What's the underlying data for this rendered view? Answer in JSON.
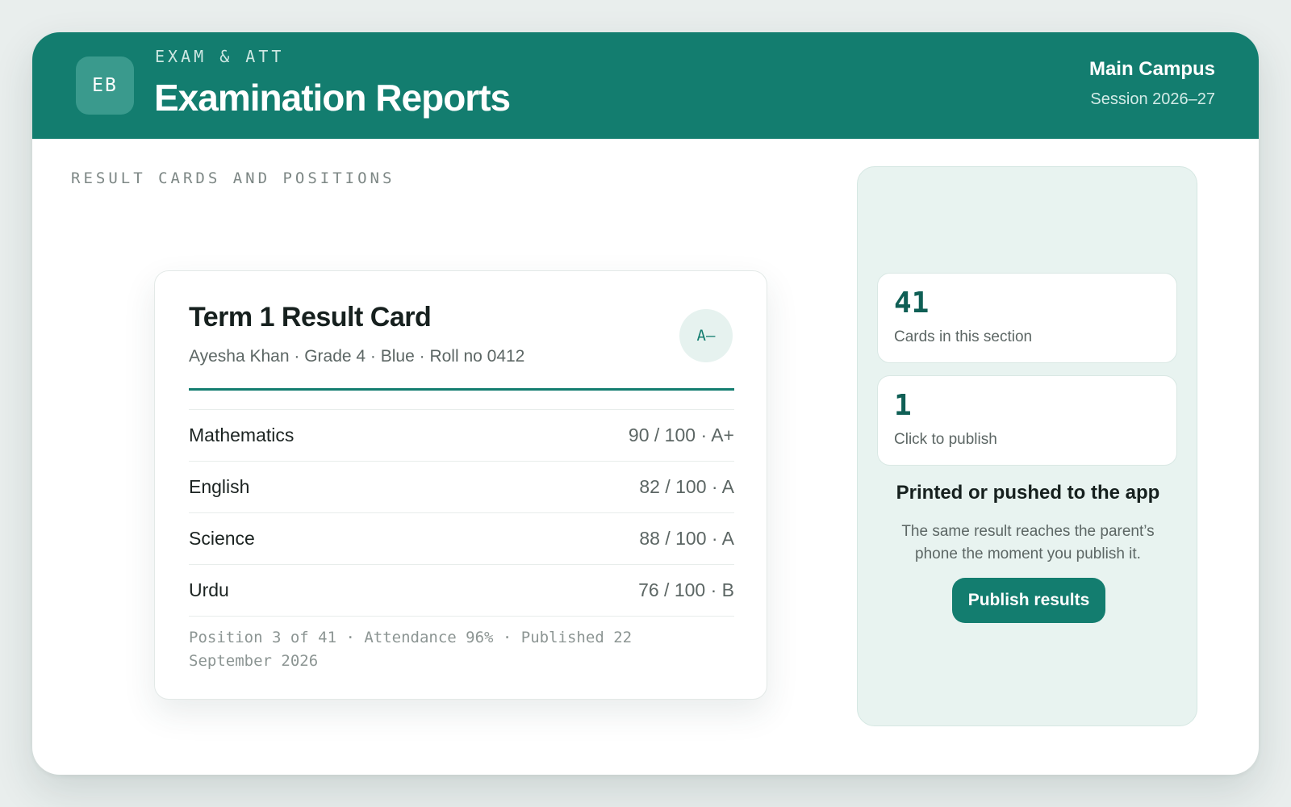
{
  "header": {
    "logo_initials": "EB",
    "kicker": "EXAM & ATT",
    "title": "Examination Reports",
    "campus": "Main Campus",
    "session": "Session 2026–27"
  },
  "main": {
    "section_label": "RESULT CARDS AND POSITIONS"
  },
  "result_card": {
    "title": "Term 1 Result Card",
    "subtitle": "Ayesha Khan · Grade 4 · Blue · Roll no 0412",
    "overall_grade": "A–",
    "subjects": [
      {
        "name": "Mathematics",
        "score": "90 / 100 · A+"
      },
      {
        "name": "English",
        "score": "82 / 100 · A"
      },
      {
        "name": "Science",
        "score": "88 / 100 · A"
      },
      {
        "name": "Urdu",
        "score": "76 / 100 · B"
      }
    ],
    "footer": "Position 3 of 41 · Attendance 96% · Published 22 September 2026"
  },
  "panel": {
    "stats": [
      {
        "value": "41",
        "label": "Cards in this section"
      },
      {
        "value": "1",
        "label": "Click to publish"
      }
    ],
    "heading": "Printed or pushed to the app",
    "body": "The same result reaches the parent’s phone the moment you publish it.",
    "publish_label": "Publish results"
  },
  "colors": {
    "brand": "#137d6f",
    "brand_dark": "#0f5f55",
    "panel_background": "#e8f3f0",
    "page_background": "#e9eeed"
  }
}
